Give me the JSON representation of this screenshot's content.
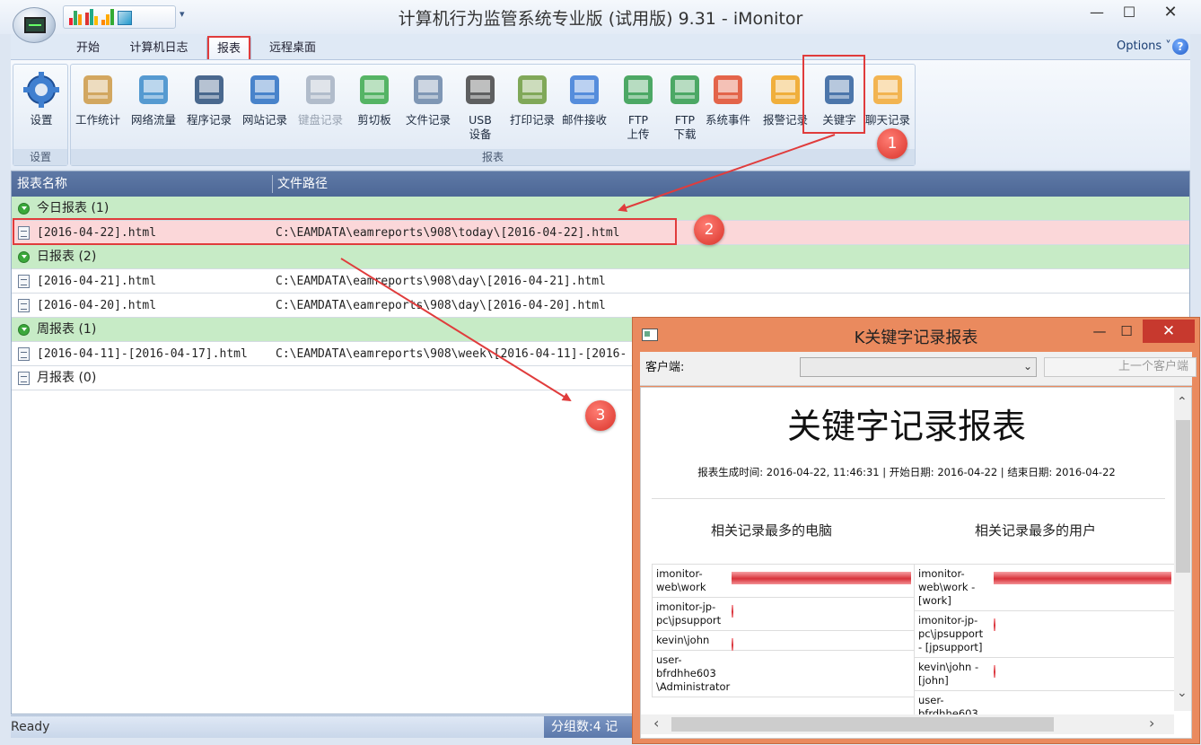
{
  "window": {
    "title": "计算机行为监管系统专业版 (试用版) 9.31 - iMonitor",
    "min": "—",
    "max": "☐",
    "close": "✕"
  },
  "tabs": [
    {
      "label": "开始"
    },
    {
      "label": "计算机日志"
    },
    {
      "label": "报表"
    },
    {
      "label": "远程桌面"
    }
  ],
  "options_label": "Options",
  "help_label": "?",
  "ribbon": {
    "settings_group": {
      "button": "设置",
      "label": "设置"
    },
    "report_group_label": "报表",
    "buttons": [
      {
        "label": "工作统计",
        "icon": "work-stats-icon"
      },
      {
        "label": "网络流量",
        "icon": "network-traffic-icon"
      },
      {
        "label": "程序记录",
        "icon": "program-log-icon"
      },
      {
        "label": "网站记录",
        "icon": "website-log-icon"
      },
      {
        "label": "键盘记录",
        "icon": "keyboard-log-icon"
      },
      {
        "label": "剪切板",
        "icon": "clipboard-icon"
      },
      {
        "label": "文件记录",
        "icon": "file-log-icon"
      },
      {
        "label": "USB 设备",
        "icon": "usb-device-icon"
      },
      {
        "label": "打印记录",
        "icon": "print-log-icon"
      },
      {
        "label": "邮件接收",
        "icon": "mail-receive-icon"
      },
      {
        "label": "FTP 上传",
        "icon": "ftp-upload-icon"
      },
      {
        "label": "FTP 下载",
        "icon": "ftp-download-icon"
      },
      {
        "label": "系统事件",
        "icon": "system-event-icon"
      },
      {
        "label": "报警记录",
        "icon": "alarm-log-icon"
      },
      {
        "label": "关键字",
        "icon": "keyword-icon"
      },
      {
        "label": "聊天记录",
        "icon": "chat-log-icon"
      }
    ]
  },
  "markers": [
    "1",
    "2",
    "3"
  ],
  "list": {
    "columns": [
      "报表名称",
      "文件路径"
    ],
    "groups": [
      {
        "label": "今日报表 (1)",
        "rows": [
          {
            "name": "[2016-04-22].html",
            "path": "C:\\EAMDATA\\eamreports\\908\\today\\[2016-04-22].html"
          }
        ]
      },
      {
        "label": "日报表 (2)",
        "rows": [
          {
            "name": "[2016-04-21].html",
            "path": "C:\\EAMDATA\\eamreports\\908\\day\\[2016-04-21].html"
          },
          {
            "name": "[2016-04-20].html",
            "path": "C:\\EAMDATA\\eamreports\\908\\day\\[2016-04-20].html"
          }
        ]
      },
      {
        "label": "周报表 (1)",
        "rows": [
          {
            "name": "[2016-04-11]-[2016-04-17].html",
            "path": "C:\\EAMDATA\\eamreports\\908\\week\\[2016-04-11]-[2016-"
          }
        ]
      }
    ],
    "month_row": "月报表 (0)"
  },
  "status": {
    "ready": "Ready",
    "right": "分组数:4  记"
  },
  "report_window": {
    "title": "K关键字记录报表",
    "client_label": "客户端:",
    "prev_client": "上一个客户端",
    "heading": "关键字记录报表",
    "meta": "报表生成时间: 2016-04-22, 11:46:31 | 开始日期: 2016-04-22 | 结束日期: 2016-04-22",
    "left_subtitle": "相关记录最多的电脑",
    "right_subtitle": "相关记录最多的用户",
    "left_rows": [
      {
        "name": "imonitor-web\\work",
        "share": 1.0
      },
      {
        "name": "imonitor-jp-pc\\jpsupport",
        "share": 0.01
      },
      {
        "name": "kevin\\john",
        "share": 0.01
      },
      {
        "name": "user-bfrdhhe603 \\Administrator",
        "share": 0
      }
    ],
    "right_rows": [
      {
        "name": "imonitor-web\\work - [work]",
        "share": 1.0
      },
      {
        "name": "imonitor-jp-pc\\jpsupport - [jpsupport]",
        "share": 0.01
      },
      {
        "name": "kevin\\john - [john]",
        "share": 0.01
      },
      {
        "name": "user-bfrdhhe603",
        "share": 0
      }
    ]
  },
  "colors": {
    "accent_red": "#e03c3c",
    "group_green": "#c7ebc6",
    "selected_row": "#fbd7d9",
    "header_blue": "#5e79a6",
    "report_window": "#ea8a5e"
  }
}
